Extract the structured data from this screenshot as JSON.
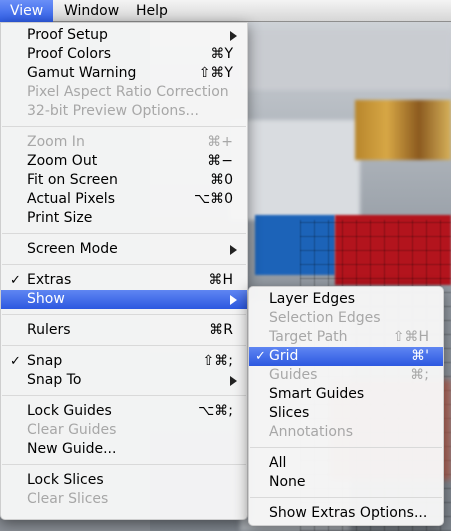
{
  "menubar": {
    "items": [
      {
        "label": "View"
      },
      {
        "label": "Window"
      },
      {
        "label": "Help"
      }
    ]
  },
  "view_menu": {
    "items": [
      {
        "label": "Proof Setup",
        "shortcut": ""
      },
      {
        "label": "Proof Colors",
        "shortcut": "⌘Y"
      },
      {
        "label": "Gamut Warning",
        "shortcut": "⇧⌘Y"
      },
      {
        "label": "Pixel Aspect Ratio Correction",
        "shortcut": ""
      },
      {
        "label": "32-bit Preview Options...",
        "shortcut": ""
      },
      {
        "label": "Zoom In",
        "shortcut": "⌘+"
      },
      {
        "label": "Zoom Out",
        "shortcut": "⌘−"
      },
      {
        "label": "Fit on Screen",
        "shortcut": "⌘0"
      },
      {
        "label": "Actual Pixels",
        "shortcut": "⌥⌘0"
      },
      {
        "label": "Print Size",
        "shortcut": ""
      },
      {
        "label": "Screen Mode",
        "shortcut": ""
      },
      {
        "label": "Extras",
        "shortcut": "⌘H",
        "check": "✓"
      },
      {
        "label": "Show",
        "shortcut": ""
      },
      {
        "label": "Rulers",
        "shortcut": "⌘R"
      },
      {
        "label": "Snap",
        "shortcut": "⇧⌘;",
        "check": "✓"
      },
      {
        "label": "Snap To",
        "shortcut": ""
      },
      {
        "label": "Lock Guides",
        "shortcut": "⌥⌘;"
      },
      {
        "label": "Clear Guides",
        "shortcut": ""
      },
      {
        "label": "New Guide...",
        "shortcut": ""
      },
      {
        "label": "Lock Slices",
        "shortcut": ""
      },
      {
        "label": "Clear Slices",
        "shortcut": ""
      }
    ]
  },
  "show_menu": {
    "items": [
      {
        "label": "Layer Edges",
        "shortcut": ""
      },
      {
        "label": "Selection Edges",
        "shortcut": ""
      },
      {
        "label": "Target Path",
        "shortcut": "⇧⌘H"
      },
      {
        "label": "Grid",
        "shortcut": "⌘'",
        "check": "✓"
      },
      {
        "label": "Guides",
        "shortcut": "⌘;"
      },
      {
        "label": "Smart Guides",
        "shortcut": ""
      },
      {
        "label": "Slices",
        "shortcut": ""
      },
      {
        "label": "Annotations",
        "shortcut": ""
      },
      {
        "label": "All",
        "shortcut": ""
      },
      {
        "label": "None",
        "shortcut": ""
      },
      {
        "label": "Show Extras Options...",
        "shortcut": ""
      }
    ]
  },
  "colors": {
    "highlight": "#2c58e0",
    "disabled_text": "#a7a7a7"
  }
}
